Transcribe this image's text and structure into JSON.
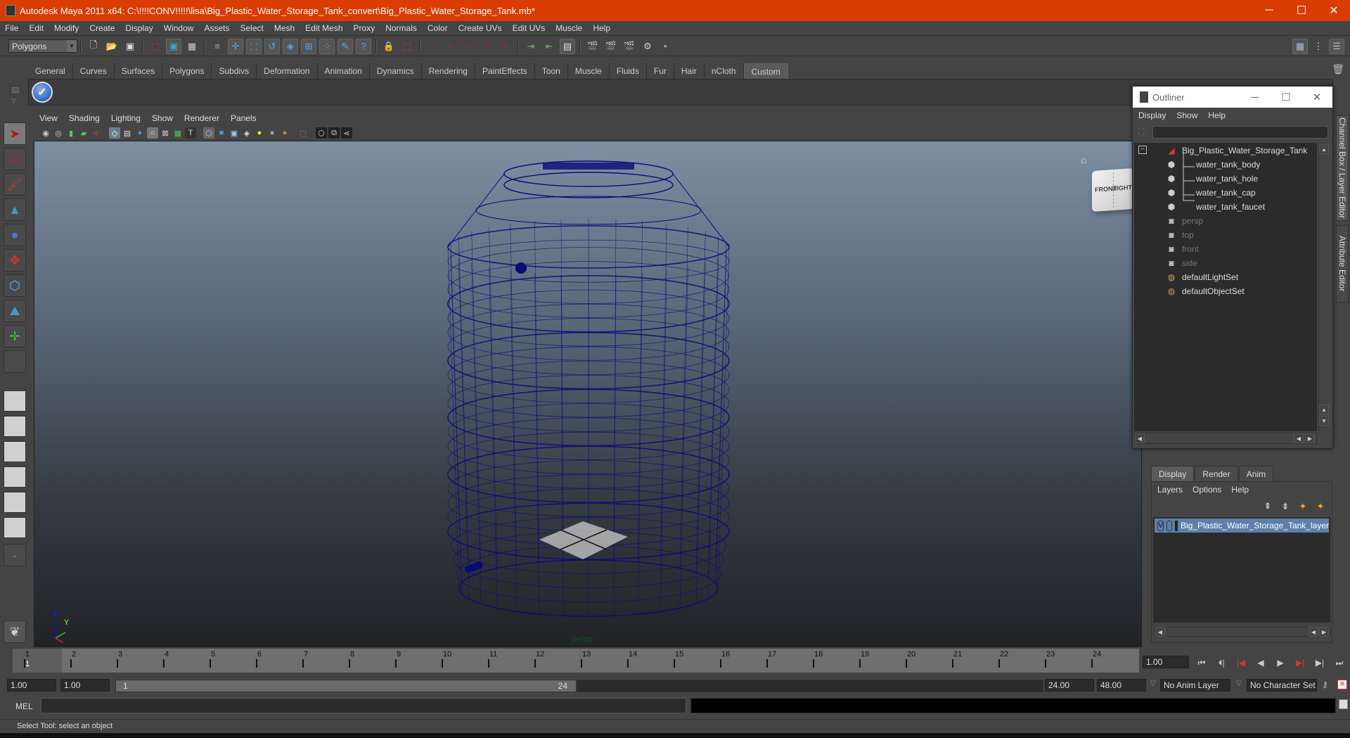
{
  "window": {
    "title": "Autodesk Maya 2011 x64: C:\\!!!!CONV!!!!!\\lisa\\Big_Plastic_Water_Storage_Tank_convert\\Big_Plastic_Water_Storage_Tank.mb*",
    "controls": {
      "minimize": "─",
      "maximize": "☐",
      "close": "✕"
    },
    "title_bar_color": "#da3c02"
  },
  "menubar": [
    "File",
    "Edit",
    "Modify",
    "Create",
    "Display",
    "Window",
    "Assets",
    "Select",
    "Mesh",
    "Edit Mesh",
    "Proxy",
    "Normals",
    "Color",
    "Create UVs",
    "Edit UVs",
    "Muscle",
    "Help"
  ],
  "statusline": {
    "mode": "Polygons",
    "icons": [
      "new-scene",
      "open-scene",
      "save-scene",
      "select-hierarchy",
      "select-object",
      "select-component",
      "snap-grid",
      "snap-curve",
      "snap-point",
      "snap-view-plane",
      "make-live",
      "history",
      "construction",
      "lock",
      "selection-highlight",
      "magnet-1",
      "magnet-2",
      "magnet-3",
      "magnet-4",
      "input-ops",
      "output-ops",
      "construction-history",
      "render-view",
      "render-current",
      "ipr-render",
      "render-settings"
    ],
    "right_icons": [
      "attribute-editor-toggle",
      "tool-settings-toggle",
      "channel-box-toggle"
    ]
  },
  "shelf": {
    "tabs": [
      "General",
      "Curves",
      "Surfaces",
      "Polygons",
      "Subdivs",
      "Deformation",
      "Animation",
      "Dynamics",
      "Rendering",
      "PaintEffects",
      "Toon",
      "Muscle",
      "Fluids",
      "Fur",
      "Hair",
      "nCloth",
      "Custom"
    ],
    "active_tab": "Custom",
    "buttons": [
      "check-mark"
    ]
  },
  "toolbox": {
    "tools": [
      "select-tool",
      "lasso-tool",
      "paint-select-tool",
      "move-tool",
      "rotate-tool",
      "scale-tool",
      "universal-manipulator",
      "soft-modification-tool",
      "show-manipulator",
      "last-tool"
    ],
    "layouts": [
      "single-perspective",
      "four-view",
      "outliner-persp",
      "persp-graph",
      "hypershade-persp",
      "persp-graph-outliner"
    ]
  },
  "viewport": {
    "menu": [
      "View",
      "Shading",
      "Lighting",
      "Show",
      "Renderer",
      "Panels"
    ],
    "camera": "persp",
    "viewcube": {
      "front": "FRONT",
      "right": "RIGHT"
    },
    "axis_labels": {
      "y": "Y",
      "z": "Z"
    },
    "wire_color": "#0a0a7a"
  },
  "outliner": {
    "title": "Outliner",
    "menu": [
      "Display",
      "Show",
      "Help"
    ],
    "items": [
      {
        "label": "Big_Plastic_Water_Storage_Tank",
        "type": "transform-group",
        "dim": false
      },
      {
        "label": "water_tank_body",
        "type": "mesh",
        "dim": false
      },
      {
        "label": "water_tank_hole",
        "type": "mesh",
        "dim": false
      },
      {
        "label": "water_tank_cap",
        "type": "mesh",
        "dim": false
      },
      {
        "label": "water_tank_faucet",
        "type": "mesh",
        "dim": false
      },
      {
        "label": "persp",
        "type": "camera",
        "dim": true
      },
      {
        "label": "top",
        "type": "camera",
        "dim": true
      },
      {
        "label": "front",
        "type": "camera",
        "dim": true
      },
      {
        "label": "side",
        "type": "camera",
        "dim": true
      },
      {
        "label": "defaultLightSet",
        "type": "set",
        "dim": false
      },
      {
        "label": "defaultObjectSet",
        "type": "set",
        "dim": false
      }
    ]
  },
  "side_tabs": [
    "Channel Box / Layer Editor",
    "Attribute Editor"
  ],
  "layer_editor": {
    "tabs": [
      "Display",
      "Render",
      "Anim"
    ],
    "active_tab": "Display",
    "menu": [
      "Layers",
      "Options",
      "Help"
    ],
    "layers": [
      {
        "visible": "V",
        "name": "Big_Plastic_Water_Storage_Tank_layer"
      }
    ],
    "highlight_color": "#5e7fa8"
  },
  "timeline": {
    "ticks": [
      1,
      2,
      3,
      4,
      5,
      6,
      7,
      8,
      9,
      10,
      11,
      12,
      13,
      14,
      15,
      16,
      17,
      18,
      19,
      20,
      21,
      22,
      23,
      24
    ],
    "current_frame_marker": "1",
    "current_time": "1.00",
    "playback_buttons": [
      "go-to-start",
      "step-back-key",
      "step-back-frame",
      "play-backwards",
      "play-forwards",
      "step-forward-frame",
      "step-forward-key",
      "go-to-end"
    ]
  },
  "range_slider": {
    "start_time": "1.00",
    "playback_start": "1.00",
    "range_start_label": "1",
    "range_end_label": "24",
    "playback_end": "24.00",
    "end_time": "48.00",
    "anim_layer": "No Anim Layer",
    "character_set": "No Character Set"
  },
  "command_line": {
    "label": "MEL",
    "input": "",
    "output": ""
  },
  "help_line": "Select Tool: select an object"
}
